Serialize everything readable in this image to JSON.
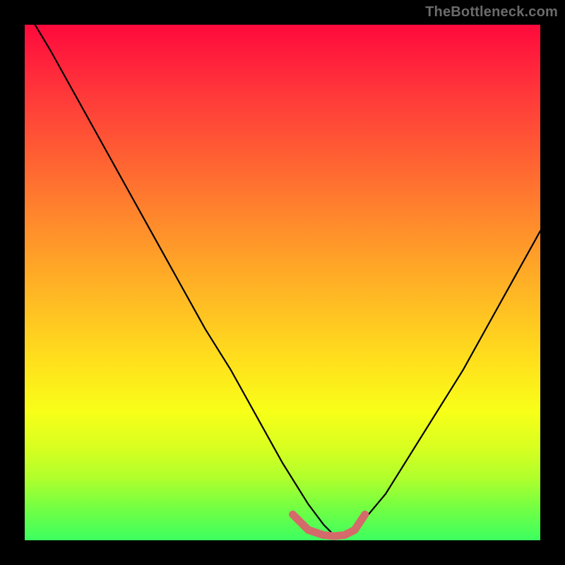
{
  "watermark": {
    "text": "TheBottleneck.com"
  },
  "colors": {
    "frame": "#000000",
    "curve": "#000000",
    "bottom_segment": "#d46a6a",
    "gradient_stops": [
      "#ff0a3c",
      "#ff1e3c",
      "#ff3a3a",
      "#ff5a34",
      "#ff7c2e",
      "#ffa028",
      "#ffc322",
      "#ffe21c",
      "#f8ff18",
      "#d8ff20",
      "#b0ff2c",
      "#7aff40",
      "#3cff60"
    ]
  },
  "chart_data": {
    "type": "line",
    "title": "",
    "xlabel": "",
    "ylabel": "",
    "xlim": [
      0,
      100
    ],
    "ylim": [
      0,
      100
    ],
    "grid": false,
    "legend": false,
    "series": [
      {
        "name": "curve",
        "x": [
          2,
          5,
          10,
          15,
          20,
          25,
          30,
          35,
          40,
          45,
          50,
          55,
          58,
          60,
          62,
          65,
          70,
          75,
          80,
          85,
          90,
          95,
          100
        ],
        "values": [
          100,
          95,
          86,
          77,
          68,
          59,
          50,
          41,
          33,
          24,
          15,
          7,
          3,
          1,
          1,
          3,
          9,
          17,
          25,
          33,
          42,
          51,
          60
        ]
      },
      {
        "name": "bottom-segment",
        "x": [
          52,
          55,
          58,
          60,
          62,
          64,
          66
        ],
        "values": [
          5,
          2,
          1,
          0.8,
          1,
          2,
          5
        ]
      }
    ],
    "annotations": [
      {
        "text": "TheBottleneck.com",
        "position": "top-right"
      }
    ]
  }
}
